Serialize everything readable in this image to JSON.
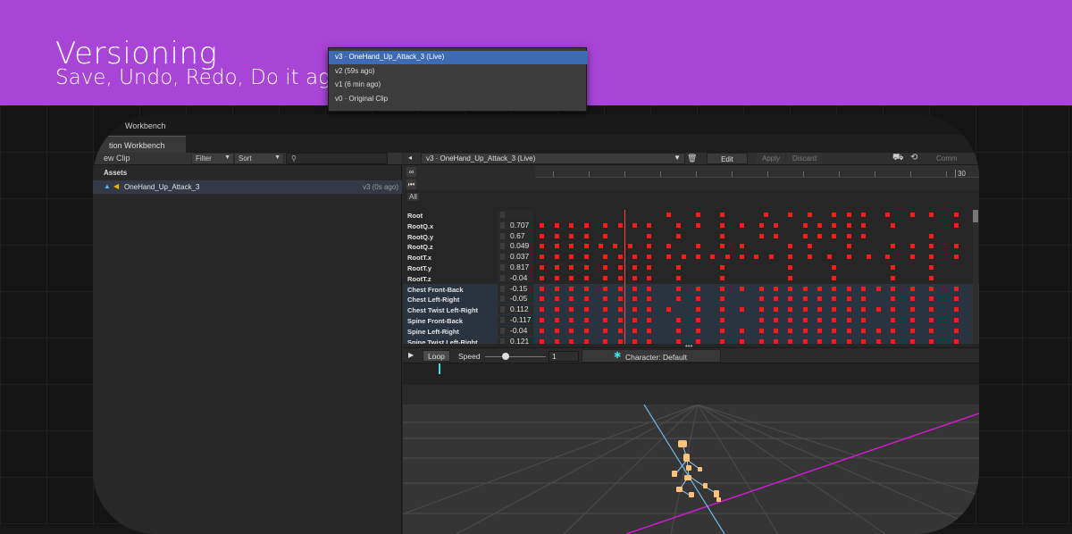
{
  "banner": {
    "title": "Versioning",
    "subtitle": "Save, Undo, Redo, Do it again!",
    "background": "#a844d6"
  },
  "window": {
    "title": "Animation Workbench",
    "title_visible": "Workbench",
    "tab_visible": "tion Workbench"
  },
  "left_panel": {
    "new_clip_label": "ew Clip",
    "filter_label": "Filter",
    "sort_label": "Sort",
    "search_icon": "search-icon",
    "assets_header": "Assets",
    "asset": {
      "name": "OneHand_Up_Attack_3",
      "version": "v3 (0s ago)"
    }
  },
  "toolbar": {
    "back_icon": "◂",
    "version_selected": "v3 · OneHand_Up_Attack_3 (Live)",
    "edit_label": "Edit",
    "apply_label": "Apply",
    "discard_label": "Discard",
    "commit_label": "Comm",
    "trash_icon": "trash-icon",
    "history_icon": "history-icon",
    "rig_icon": "rig-icon"
  },
  "version_dropdown": {
    "items": [
      {
        "label": "v3 · OneHand_Up_Attack_3 (Live)",
        "selected": true
      },
      {
        "label": "v2 (59s ago)",
        "selected": false
      },
      {
        "label": "v1 (6 min ago)",
        "selected": false
      },
      {
        "label": "v0 · Original Clip",
        "selected": false
      }
    ]
  },
  "timeline": {
    "all_label": "All",
    "frame_label_end": "30",
    "rows": [
      {
        "label": "Root",
        "value": "",
        "dots": [
          27,
          33,
          38,
          47,
          52,
          56,
          61,
          64,
          67,
          72,
          77,
          81,
          86
        ]
      },
      {
        "label": "RootQ.x",
        "value": "0.707",
        "dots": [
          1,
          4,
          7,
          10,
          14,
          17,
          20,
          23,
          29,
          33,
          38,
          42,
          46,
          49,
          55,
          58,
          61,
          64,
          67,
          73,
          86
        ]
      },
      {
        "label": "RootQ.y",
        "value": "0.67",
        "dots": [
          1,
          4,
          7,
          10,
          14,
          23,
          29,
          38,
          46,
          49,
          55,
          58,
          61,
          64,
          67,
          81
        ]
      },
      {
        "label": "RootQ.z",
        "value": "0.049",
        "dots": [
          1,
          4,
          7,
          10,
          13,
          16,
          19,
          23,
          27,
          33,
          38,
          42,
          52,
          56,
          64,
          73,
          77,
          81,
          86
        ]
      },
      {
        "label": "RootT.x",
        "value": "0.037",
        "dots": [
          1,
          4,
          7,
          10,
          14,
          17,
          20,
          23,
          27,
          30,
          33,
          36,
          39,
          42,
          45,
          48,
          52,
          56,
          60,
          64,
          68,
          72,
          77,
          81,
          86
        ]
      },
      {
        "label": "RootT.y",
        "value": "0.817",
        "dots": [
          1,
          4,
          7,
          10,
          14,
          17,
          20,
          23,
          29,
          38,
          52,
          61,
          73,
          81
        ]
      },
      {
        "label": "RootT.z",
        "value": "-0.04",
        "dots": [
          1,
          4,
          7,
          10,
          14,
          17,
          20,
          23,
          29,
          38,
          52,
          61,
          73,
          81
        ]
      },
      {
        "label": "Chest Front-Back",
        "value": "-0.15",
        "dots": [
          1,
          4,
          7,
          10,
          14,
          17,
          20,
          23,
          29,
          33,
          38,
          42,
          46,
          49,
          52,
          55,
          58,
          61,
          64,
          67,
          70,
          73,
          77,
          81,
          86
        ]
      },
      {
        "label": "Chest Left-Right",
        "value": "-0.05",
        "dots": [
          1,
          4,
          7,
          10,
          14,
          17,
          20,
          23,
          29,
          33,
          38,
          46,
          49,
          52,
          55,
          58,
          61,
          64,
          67,
          73,
          77,
          81,
          86
        ]
      },
      {
        "label": "Chest Twist Left-Right",
        "value": "0.112",
        "dots": [
          1,
          4,
          7,
          10,
          14,
          17,
          20,
          23,
          27,
          33,
          38,
          42,
          46,
          49,
          52,
          55,
          58,
          61,
          64,
          67,
          70,
          73,
          77,
          81,
          86
        ]
      },
      {
        "label": "Spine Front-Back",
        "value": "-0.117",
        "dots": [
          1,
          4,
          7,
          10,
          14,
          17,
          20,
          23,
          29,
          33,
          38,
          46,
          49,
          52,
          55,
          58,
          61,
          64,
          67,
          73,
          77,
          81,
          86
        ]
      },
      {
        "label": "Spine Left-Right",
        "value": "-0.04",
        "dots": [
          1,
          4,
          7,
          10,
          14,
          17,
          20,
          23,
          29,
          33,
          38,
          42,
          46,
          49,
          52,
          55,
          58,
          61,
          64,
          67,
          70,
          73,
          77,
          81,
          86
        ]
      },
      {
        "label": "Spine Twist Left-Right",
        "value": "0.121",
        "dots": [
          1,
          4,
          7,
          10,
          14,
          17,
          20,
          23,
          29,
          33,
          38,
          42,
          46,
          49,
          52,
          55,
          58,
          61,
          64,
          67,
          70,
          73,
          77,
          81,
          86
        ]
      }
    ],
    "dot_color": "#ff1a1a"
  },
  "playback": {
    "play_icon": "play-icon",
    "loop_label": "Loop",
    "speed_label": "Speed",
    "speed_value": "1",
    "character_label": "Character: Default",
    "character_icon": "character-icon"
  },
  "viewport": {
    "grid_color": "#4d4d4d",
    "x_axis_color": "#d01ad0",
    "z_axis_color": "#6fb8e8",
    "bone_color": "#ffc27a"
  }
}
